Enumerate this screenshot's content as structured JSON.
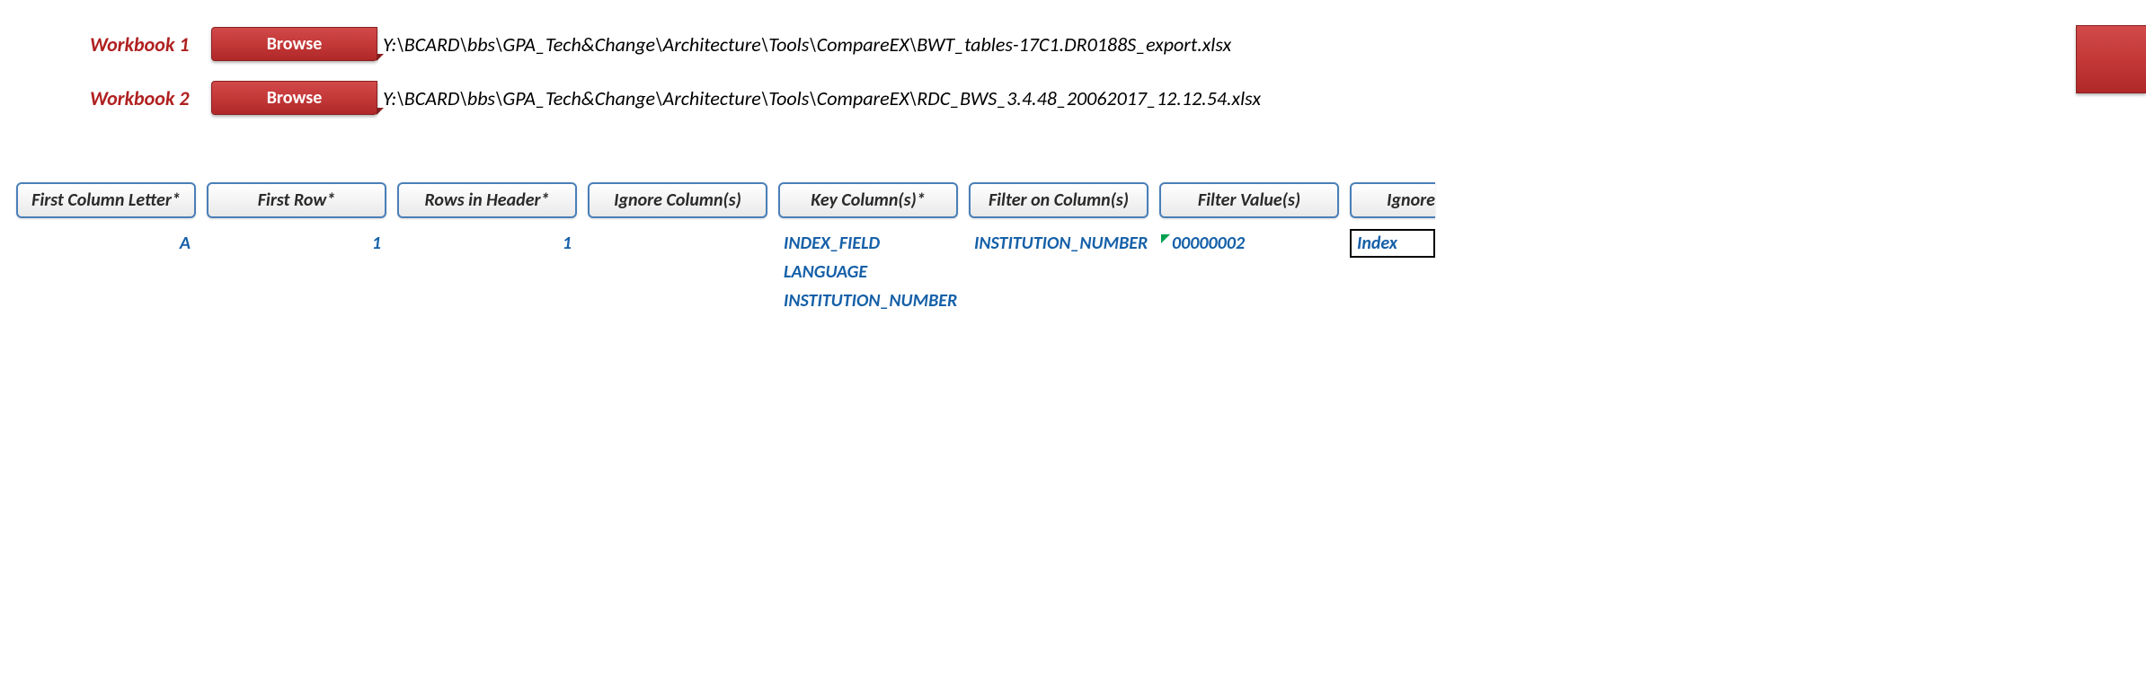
{
  "workbooks": {
    "wb1": {
      "label": "Workbook 1",
      "browse_label": "Browse",
      "path": "Y:\\BCARD\\bbs\\GPA_Tech&Change\\Architecture\\Tools\\CompareEX\\BWT_tables-17C1.DR0188S_export.xlsx"
    },
    "wb2": {
      "label": "Workbook 2",
      "browse_label": "Browse",
      "path": "Y:\\BCARD\\bbs\\GPA_Tech&Change\\Architecture\\Tools\\CompareEX\\RDC_BWS_3.4.48_20062017_12.12.54.xlsx"
    }
  },
  "columns": {
    "first_column_letter": {
      "header": "First Column Letter*",
      "value": "A"
    },
    "first_row": {
      "header": "First Row*",
      "value": "1"
    },
    "rows_in_header": {
      "header": "Rows in Header*",
      "value": "1"
    },
    "ignore_columns": {
      "header": "Ignore Column(s)",
      "value": ""
    },
    "key_columns": {
      "header": "Key Column(s)*",
      "value1": "INDEX_FIELD",
      "value2": "LANGUAGE",
      "value3": "INSTITUTION_NUMBER"
    },
    "filter_on_columns": {
      "header": "Filter on Column(s)",
      "value": "INSTITUTION_NUMBER"
    },
    "filter_values": {
      "header": "Filter Value(s)",
      "value": "00000002"
    },
    "ignore_partial": {
      "header": "Ignore",
      "value": "Index"
    }
  }
}
